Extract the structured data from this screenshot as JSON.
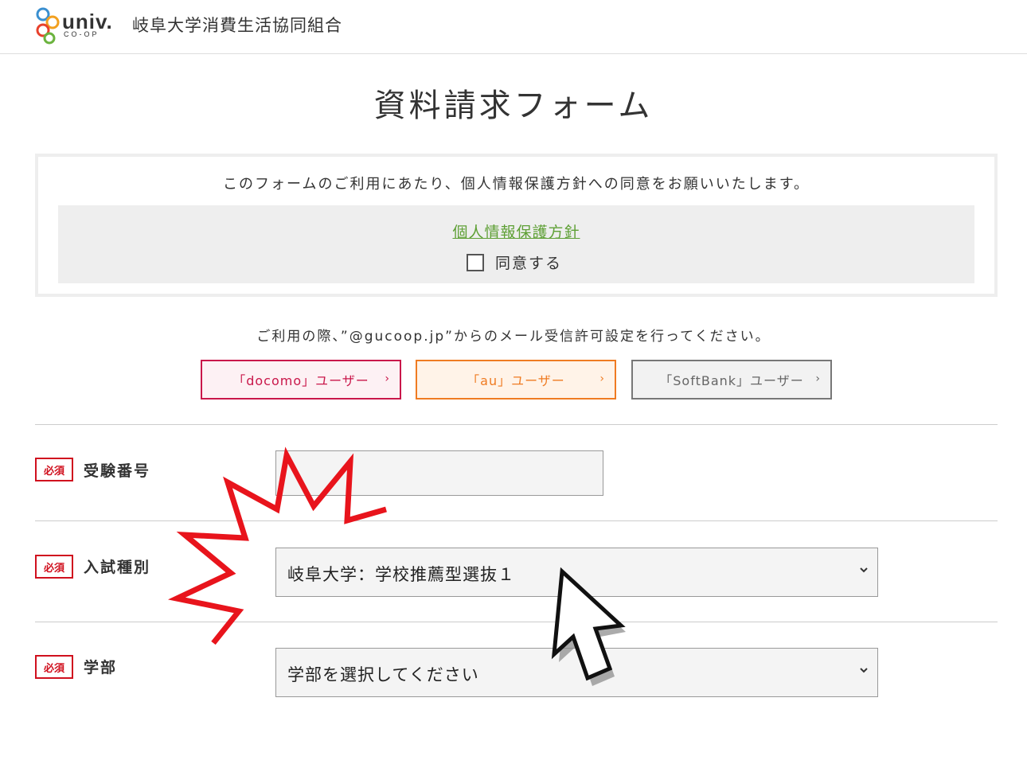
{
  "header": {
    "logo_text": "univ.",
    "logo_sub": "CO-OP",
    "org_name": "岐阜大学消費生活協同組合"
  },
  "page_title": "資料請求フォーム",
  "consent": {
    "message": "このフォームのご利用にあたり、個人情報保護方針への同意をお願いいたします。",
    "privacy_link": "個人情報保護方針",
    "agree_label": "同意する"
  },
  "mail_note": "ご利用の際、”@gucoop.jp”からのメール受信許可設定を行ってください。",
  "carriers": {
    "docomo": "「docomo」ユーザー",
    "au": "「au」ユーザー",
    "softbank": "「SoftBank」ユーザー"
  },
  "fields": {
    "exam_number": {
      "badge": "必須",
      "label": "受験番号",
      "value": ""
    },
    "exam_type": {
      "badge": "必須",
      "label": "入試種別",
      "selected": "岐阜大学：学校推薦型選抜１"
    },
    "faculty": {
      "badge": "必須",
      "label": "学部",
      "selected": "学部を選択してください"
    }
  },
  "colors": {
    "docomo": "#c9174a",
    "au": "#ef7b22",
    "softbank": "#777777",
    "required": "#d0101e",
    "link": "#5fa036",
    "annotation": "#e8141c"
  },
  "icons": [
    "logo-icon",
    "chevron-right-icon",
    "chevron-down-icon",
    "burst-annotation-icon",
    "cursor-arrow-icon"
  ]
}
